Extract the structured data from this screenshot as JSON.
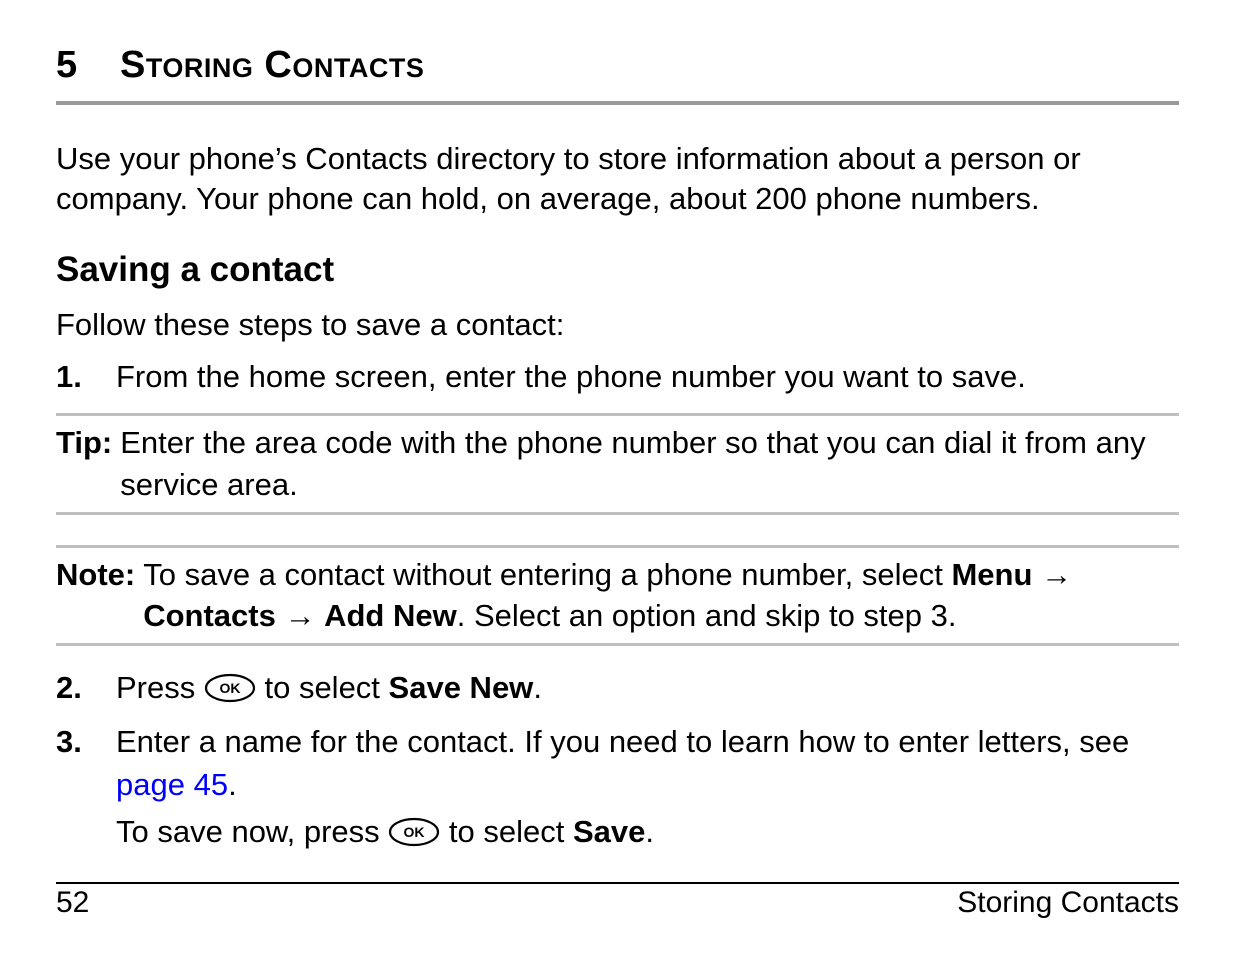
{
  "chapter": {
    "number": "5",
    "title_smallcaps": "Storing Contacts"
  },
  "intro": "Use your phone’s Contacts directory to store information about a person or company. Your phone can hold, on average, about 200 phone numbers.",
  "section_heading": "Saving a contact",
  "section_intro": "Follow these steps to save a contact:",
  "steps": {
    "s1": {
      "num": "1.",
      "text": "From the home screen, enter the phone number you want to save."
    },
    "s2": {
      "num": "2.",
      "pre": "Press ",
      "post": " to select ",
      "bold": "Save New",
      "period": "."
    },
    "s3": {
      "num": "3.",
      "line1_a": "Enter a name for the contact. If you need to learn how to enter letters, see ",
      "link": "page 45",
      "line1_b": ".",
      "line2_a": "To save now, press ",
      "line2_b": " to select ",
      "line2_bold": "Save",
      "line2_c": "."
    }
  },
  "tip": {
    "label": "Tip:",
    "text": "Enter the area code with the phone number so that you can dial it from any service area."
  },
  "note": {
    "label": "Note:",
    "part_a": "To save a contact without entering a phone number, select ",
    "menu": "Menu",
    "arrow": " → ",
    "contacts": "Contacts",
    "addnew": "Add New",
    "part_b": ". Select an option and skip to step 3."
  },
  "ok_label": "OK",
  "footer": {
    "page_number": "52",
    "running_head": "Storing Contacts"
  }
}
